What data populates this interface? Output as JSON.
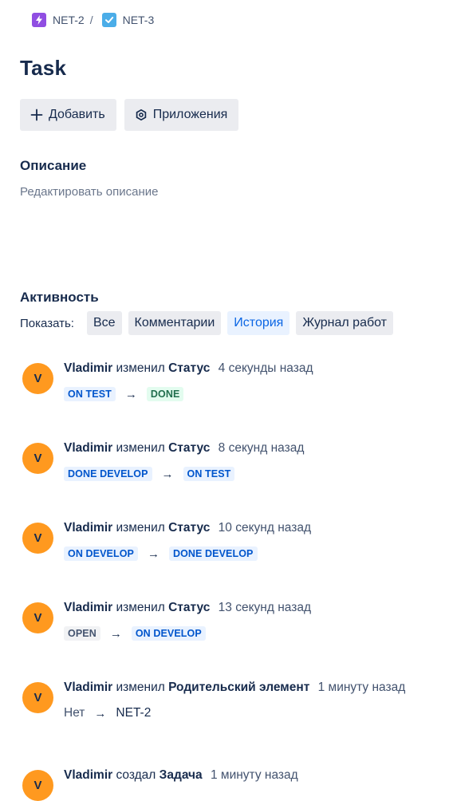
{
  "breadcrumb": {
    "parent": {
      "key": "NET-2",
      "icon": "epic-lightning-icon",
      "color": "#904ee2"
    },
    "separator": "/",
    "current": {
      "key": "NET-3",
      "icon": "task-checkbox-icon",
      "color": "#4bade8"
    }
  },
  "issue": {
    "title": "Task"
  },
  "toolbar": {
    "add_label": "Добавить",
    "apps_label": "Приложения"
  },
  "description": {
    "heading": "Описание",
    "placeholder": "Редактировать описание"
  },
  "activity": {
    "heading": "Активность",
    "show_label": "Показать:",
    "filters": [
      {
        "label": "Все",
        "active": false
      },
      {
        "label": "Комментарии",
        "active": false
      },
      {
        "label": "История",
        "active": true
      },
      {
        "label": "Журнал работ",
        "active": false
      }
    ],
    "entries": [
      {
        "initial": "V",
        "user": "Vladimir",
        "action": "изменил",
        "field": "Статус",
        "time": "4 секунды назад",
        "from": "ON TEST",
        "to": "DONE"
      },
      {
        "initial": "V",
        "user": "Vladimir",
        "action": "изменил",
        "field": "Статус",
        "time": "8 секунд назад",
        "from": "DONE DEVELOP",
        "to": "ON TEST"
      },
      {
        "initial": "V",
        "user": "Vladimir",
        "action": "изменил",
        "field": "Статус",
        "time": "10 секунд назад",
        "from": "ON DEVELOP",
        "to": "DONE DEVELOP"
      },
      {
        "initial": "V",
        "user": "Vladimir",
        "action": "изменил",
        "field": "Статус",
        "time": "13 секунд назад",
        "from": "OPEN",
        "to": "ON DEVELOP"
      },
      {
        "initial": "V",
        "user": "Vladimir",
        "action": "изменил",
        "field": "Родительский элемент",
        "time": "1 минуту назад",
        "from": "Нет",
        "to": "NET-2"
      },
      {
        "initial": "V",
        "user": "Vladimir",
        "action": "создал",
        "field": "Задача",
        "time": "1 минуту назад"
      }
    ],
    "arrow": "→"
  },
  "colors": {
    "avatar": "#ff991f",
    "active_filter": "#0c66e4",
    "status_blue": "#0055cc",
    "status_green": "#216e4e"
  }
}
